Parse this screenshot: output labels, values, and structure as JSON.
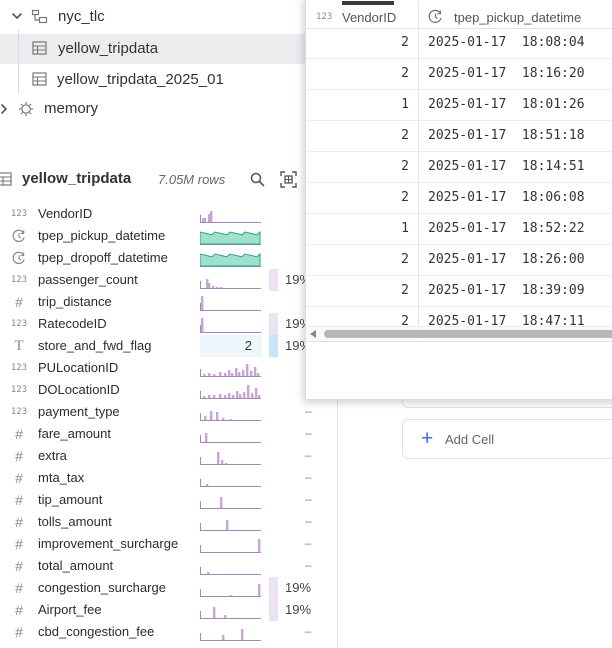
{
  "tree": {
    "schema": {
      "label": "nyc_tlc",
      "icon": "schema-icon",
      "expanded": true
    },
    "tables": [
      {
        "label": "yellow_tripdata",
        "icon": "table-icon",
        "selected": true
      },
      {
        "label": "yellow_tripdata_2025_01",
        "icon": "table-icon",
        "selected": false
      }
    ],
    "database": {
      "label": "memory",
      "icon": "database-icon",
      "expanded": false
    }
  },
  "table_panel": {
    "title": "yellow_tripdata",
    "row_count": "7.05M rows",
    "icons": [
      "table-icon",
      "search-icon",
      "preview-icon"
    ],
    "columns": [
      {
        "type": "123",
        "name": "VendorID",
        "spark": "bars-vendor",
        "pct": "",
        "dash": ""
      },
      {
        "type": "clock",
        "name": "tpep_pickup_datetime",
        "spark": "area",
        "pct": "",
        "dash": ""
      },
      {
        "type": "clock",
        "name": "tpep_dropoff_datetime",
        "spark": "area",
        "pct": "",
        "dash": ""
      },
      {
        "type": "123",
        "name": "passenger_count",
        "spark": "bars-passenger",
        "pct": "19%",
        "dash": ""
      },
      {
        "type": "#",
        "name": "trip_distance",
        "spark": "bars-distance",
        "pct": "",
        "dash": ""
      },
      {
        "type": "123",
        "name": "RatecodeID",
        "spark": "bars-ratecode",
        "pct": "19%",
        "dash": ""
      },
      {
        "type": "T",
        "name": "store_and_fwd_flag",
        "spark": "categorical",
        "category_count": "2",
        "pct": "19%",
        "dash": ""
      },
      {
        "type": "123",
        "name": "PULocationID",
        "spark": "bars-location",
        "pct": "",
        "dash": ""
      },
      {
        "type": "123",
        "name": "DOLocationID",
        "spark": "bars-location2",
        "pct": "",
        "dash": ""
      },
      {
        "type": "123",
        "name": "payment_type",
        "spark": "bars-payment",
        "pct": "",
        "dash": "–"
      },
      {
        "type": "#",
        "name": "fare_amount",
        "spark": "bars-fare",
        "pct": "",
        "dash": "–"
      },
      {
        "type": "#",
        "name": "extra",
        "spark": "bars-extra",
        "pct": "",
        "dash": "–"
      },
      {
        "type": "#",
        "name": "mta_tax",
        "spark": "bars-mta",
        "pct": "",
        "dash": "–"
      },
      {
        "type": "#",
        "name": "tip_amount",
        "spark": "bars-tip",
        "pct": "",
        "dash": "–"
      },
      {
        "type": "#",
        "name": "tolls_amount",
        "spark": "bars-tolls",
        "pct": "",
        "dash": "–"
      },
      {
        "type": "#",
        "name": "improvement_surcharge",
        "spark": "bars-improve",
        "pct": "",
        "dash": "–"
      },
      {
        "type": "#",
        "name": "total_amount",
        "spark": "bars-total",
        "pct": "",
        "dash": "–"
      },
      {
        "type": "#",
        "name": "congestion_surcharge",
        "spark": "bars-congestion",
        "pct": "19%",
        "dash": ""
      },
      {
        "type": "#",
        "name": "Airport_fee",
        "spark": "bars-airport",
        "pct": "19%",
        "dash": ""
      },
      {
        "type": "#",
        "name": "cbd_congestion_fee",
        "spark": "bars-cbd",
        "pct": "",
        "dash": "–"
      }
    ]
  },
  "notebook": {
    "add_cell_label": "Add Cell",
    "add_cell_icon": "plus-icon"
  },
  "preview": {
    "columns": [
      {
        "type": "123",
        "label": "VendorID"
      },
      {
        "type": "clock",
        "label": "tpep_pickup_datetime"
      }
    ],
    "rows": [
      {
        "vendor": "2",
        "pickup": "2025-01-17  18:08:04"
      },
      {
        "vendor": "2",
        "pickup": "2025-01-17  18:16:20"
      },
      {
        "vendor": "1",
        "pickup": "2025-01-17  18:01:26"
      },
      {
        "vendor": "2",
        "pickup": "2025-01-17  18:51:18"
      },
      {
        "vendor": "2",
        "pickup": "2025-01-17  18:14:51"
      },
      {
        "vendor": "2",
        "pickup": "2025-01-17  18:06:08"
      },
      {
        "vendor": "1",
        "pickup": "2025-01-17  18:52:22"
      },
      {
        "vendor": "2",
        "pickup": "2025-01-17  18:26:00"
      },
      {
        "vendor": "2",
        "pickup": "2025-01-17  18:39:09"
      },
      {
        "vendor": "2",
        "pickup": "2025-01-17  18:47:11"
      }
    ]
  },
  "colors": {
    "histogram": "#c9a5d6",
    "area_fill": "#9fe0cf",
    "area_line": "#2aa58a",
    "accent": "#3d6fd6"
  }
}
